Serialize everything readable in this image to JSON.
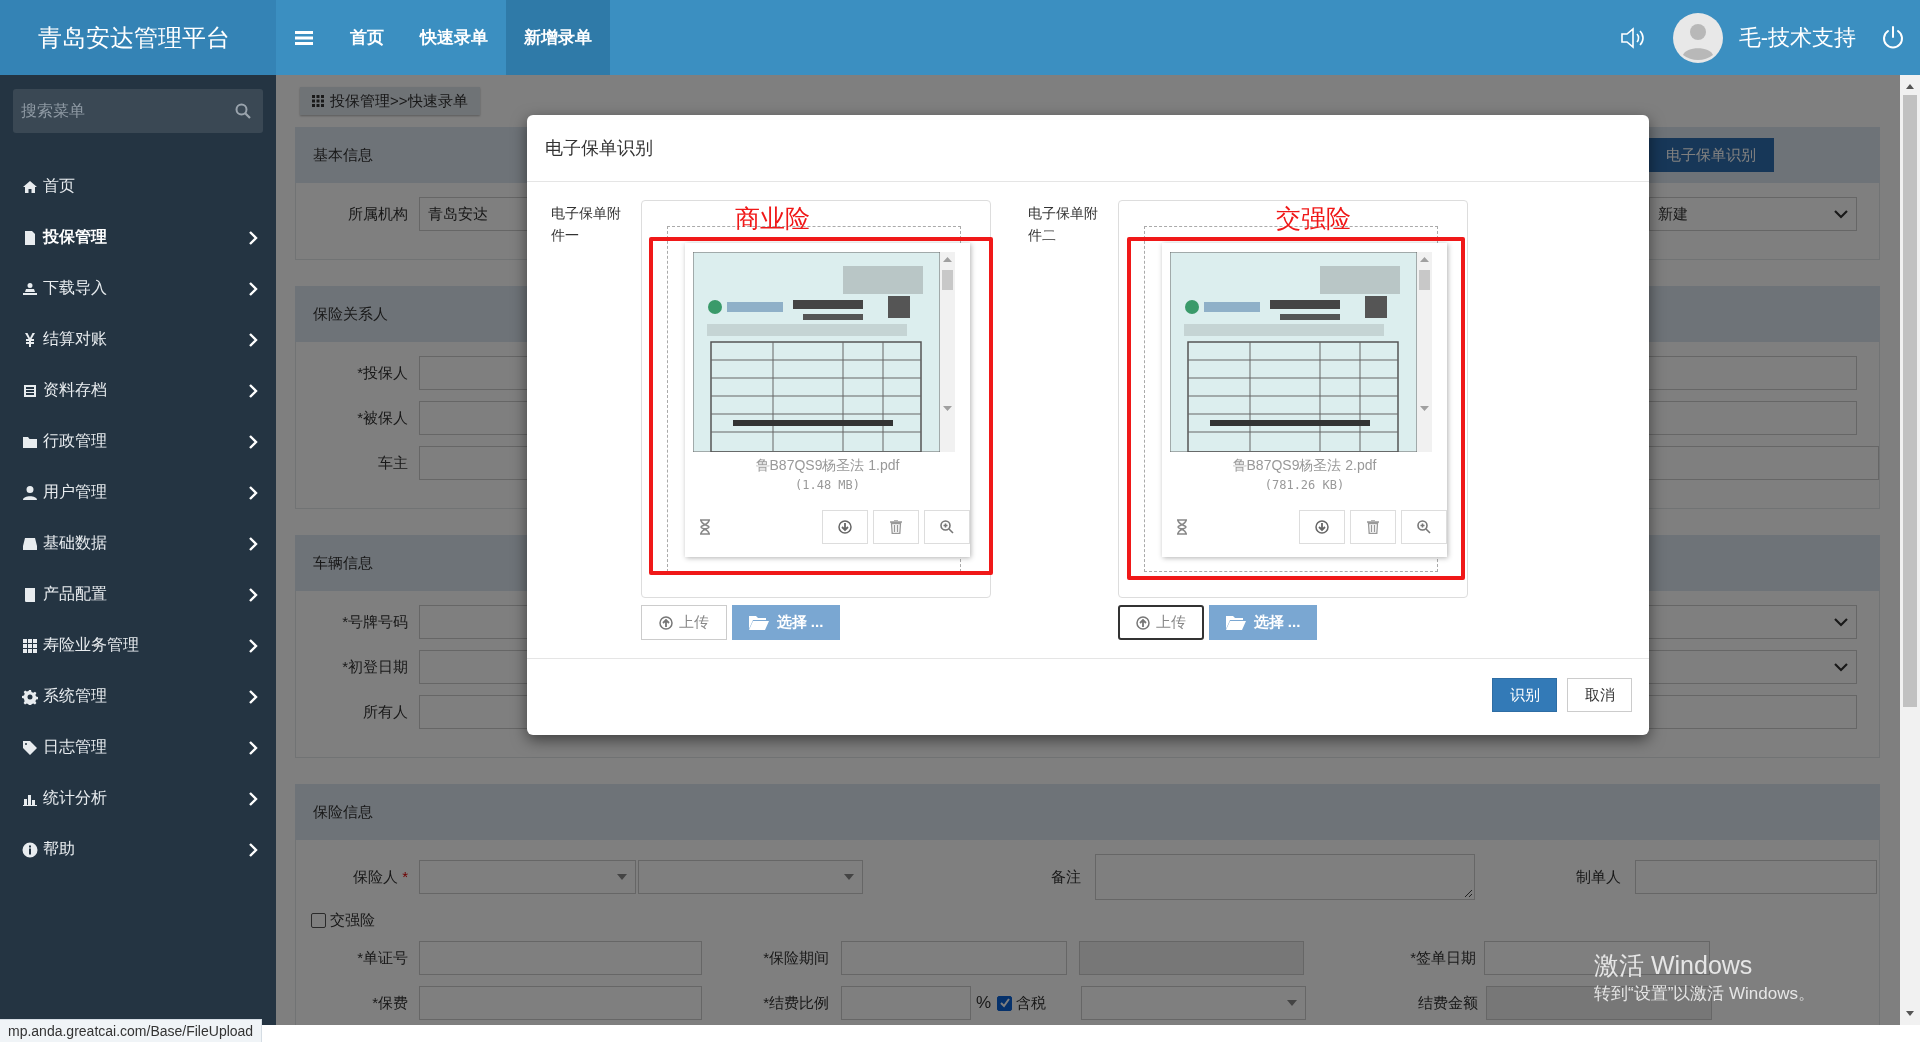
{
  "header": {
    "brand": "青岛安达管理平台",
    "nav": [
      {
        "label": "首页",
        "selected": false
      },
      {
        "label": "快速录单",
        "selected": false
      },
      {
        "label": "新增录单",
        "selected": true
      }
    ],
    "user_name": "毛-技术支持"
  },
  "sidebar": {
    "search": {
      "placeholder": "搜索菜单"
    },
    "items": [
      {
        "label": "首页",
        "selected": false,
        "expandable": false
      },
      {
        "label": "投保管理",
        "selected": true,
        "expandable": true
      },
      {
        "label": "下载导入",
        "selected": false,
        "expandable": true
      },
      {
        "label": "结算对账",
        "selected": false,
        "expandable": true
      },
      {
        "label": "资料存档",
        "selected": false,
        "expandable": true
      },
      {
        "label": "行政管理",
        "selected": false,
        "expandable": true
      },
      {
        "label": "用户管理",
        "selected": false,
        "expandable": true
      },
      {
        "label": "基础数据",
        "selected": false,
        "expandable": true
      },
      {
        "label": "产品配置",
        "selected": false,
        "expandable": true
      },
      {
        "label": "寿险业务管理",
        "selected": false,
        "expandable": true
      },
      {
        "label": "系统管理",
        "selected": false,
        "expandable": true
      },
      {
        "label": "日志管理",
        "selected": false,
        "expandable": true
      },
      {
        "label": "统计分析",
        "selected": false,
        "expandable": true
      },
      {
        "label": "帮助",
        "selected": false,
        "expandable": true
      }
    ]
  },
  "breadcrumb": "投保管理>>快速录单",
  "form": {
    "sections": [
      {
        "title": "基本信息",
        "action": "电子保单识别",
        "rows": [
          [
            {
              "label": "所属机构",
              "controls": [
                {
                  "kind": "input",
                  "value": "青岛安达"
                }
              ]
            },
            {
              "controls": [
                {
                  "kind": "select",
                  "value": "新建"
                }
              ]
            }
          ]
        ]
      },
      {
        "title": "保险关系人",
        "rows": [
          [
            {
              "label": "*投保人",
              "controls": [
                {
                  "kind": "input"
                }
              ]
            }
          ],
          [
            {
              "label": "*被保人",
              "controls": [
                {
                  "kind": "input"
                }
              ]
            }
          ],
          [
            {
              "label": "车主",
              "controls": [
                {
                  "kind": "input"
                }
              ]
            }
          ]
        ]
      },
      {
        "title": "车辆信息",
        "rows": [
          [
            {
              "label": "*号牌号码",
              "controls": [
                {
                  "kind": "select"
                }
              ]
            }
          ],
          [
            {
              "label": "*初登日期",
              "controls": [
                {
                  "kind": "select"
                }
              ]
            }
          ],
          [
            {
              "label": "所有人",
              "controls": [
                {
                  "kind": "input"
                }
              ]
            }
          ]
        ]
      },
      {
        "title": "保险信息",
        "rows": [
          [
            {
              "label": "保险人",
              "required_mark": "*",
              "controls": [
                {
                  "kind": "combo"
                },
                {
                  "kind": "combo"
                }
              ]
            },
            {
              "label": "备注",
              "controls": [
                {
                  "kind": "textarea"
                }
              ]
            },
            {
              "label": "制单人",
              "controls": [
                {
                  "kind": "input"
                }
              ]
            }
          ],
          [
            {
              "controls": [
                {
                  "kind": "checkbox",
                  "text": "交强险",
                  "checked": false
                }
              ]
            }
          ],
          [
            {
              "label": "*单证号",
              "controls": [
                {
                  "kind": "input"
                }
              ]
            },
            {
              "label": "*保险期间",
              "controls": [
                {
                  "kind": "input"
                },
                {
                  "kind": "readonly"
                }
              ]
            },
            {
              "label": "*签单日期",
              "controls": [
                {
                  "kind": "input"
                }
              ]
            }
          ],
          [
            {
              "label": "*保费",
              "controls": [
                {
                  "kind": "input"
                }
              ]
            },
            {
              "label": "*结费比例",
              "controls": [
                {
                  "kind": "input"
                },
                {
                  "kind": "text",
                  "text": "%"
                },
                {
                  "kind": "checkbox",
                  "text": "含税",
                  "checked": true
                },
                {
                  "kind": "combo"
                }
              ]
            },
            {
              "label": "结费金额",
              "controls": [
                {
                  "kind": "readonly"
                }
              ]
            }
          ]
        ]
      }
    ]
  },
  "modal": {
    "title": "电子保单识别",
    "attachments": [
      {
        "label": "电子保单附件一",
        "annotation": "商业险",
        "file_name": "鲁B87QS9杨圣法 1.pdf",
        "file_size": "(1.48 MB)",
        "upload_button": "上传",
        "upload_focused": false,
        "browse_button": "选择 ..."
      },
      {
        "label": "电子保单附件二",
        "annotation": "交强险",
        "file_name": "鲁B87QS9杨圣法 2.pdf",
        "file_size": "(781.26 KB)",
        "upload_button": "上传",
        "upload_focused": true,
        "browse_button": "选择 ..."
      }
    ],
    "buttons": [
      {
        "label": "识别",
        "kind": "primary"
      },
      {
        "label": "取消",
        "kind": "default"
      }
    ]
  },
  "os_watermark": {
    "title": "激活 Windows",
    "hint": "转到“设置”以激活 Windows。"
  },
  "status_url": "mp.anda.greatcai.com/Base/FileUpload"
}
